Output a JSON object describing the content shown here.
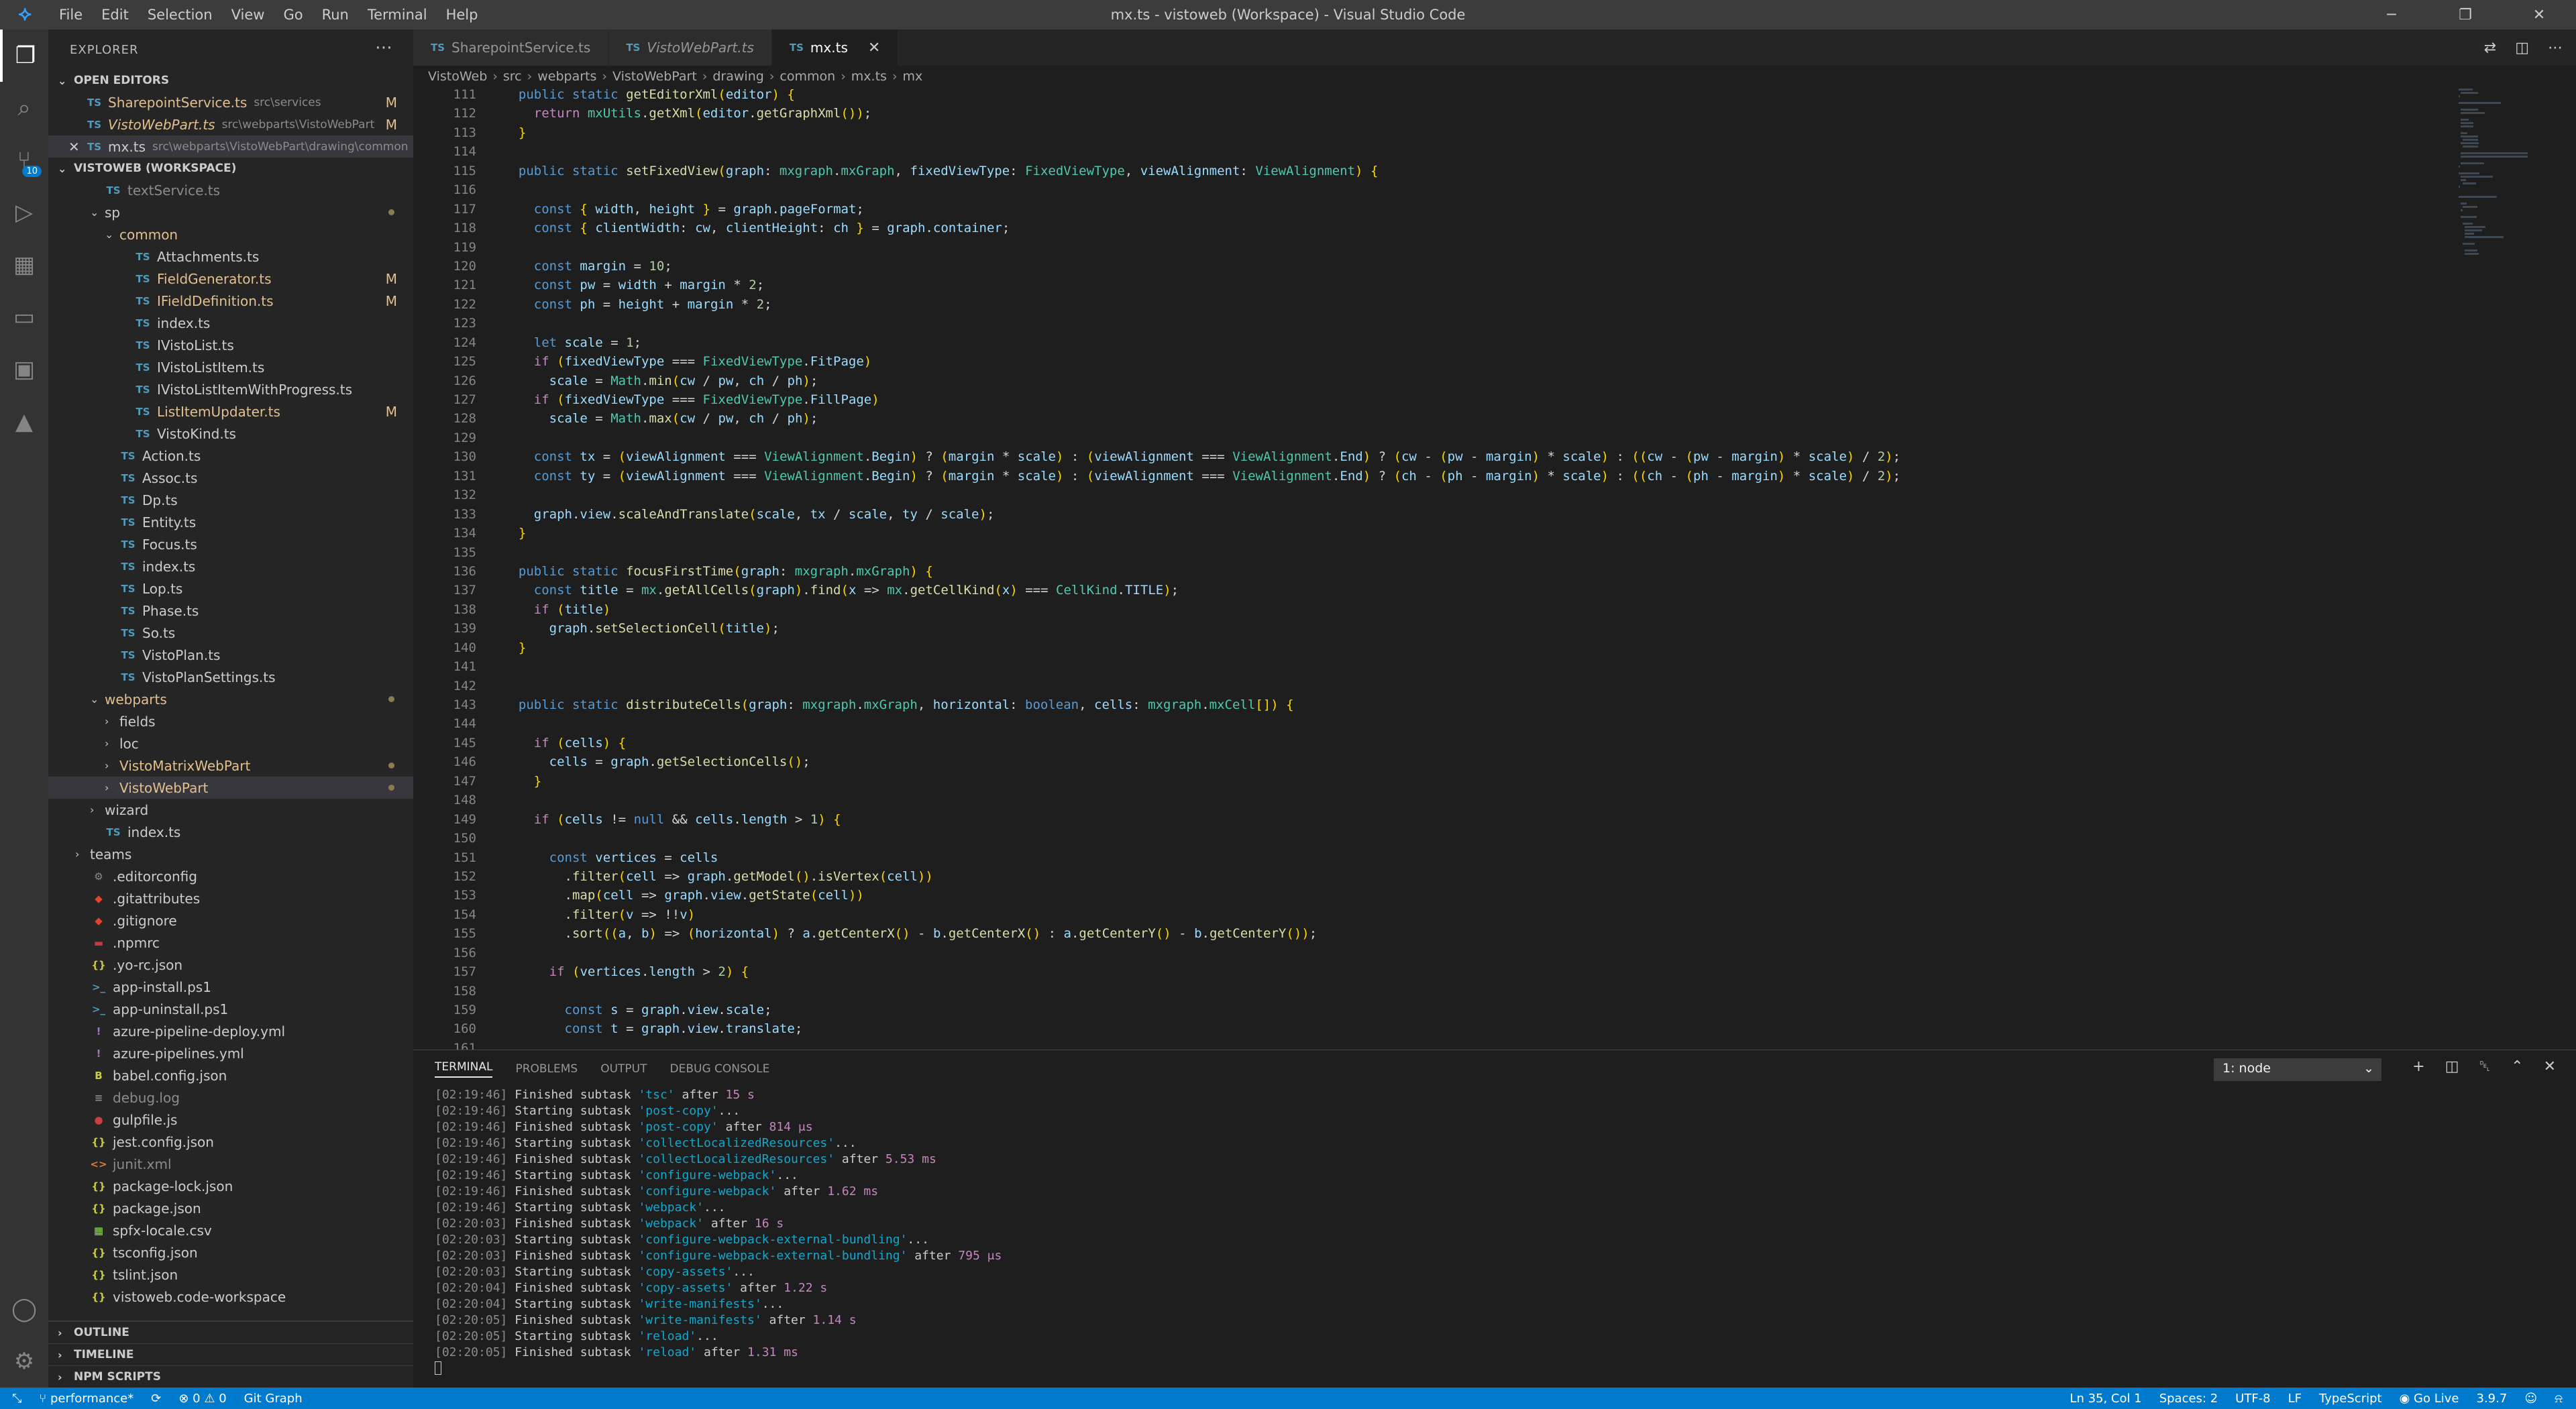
{
  "titlebar": {
    "menu": [
      "File",
      "Edit",
      "Selection",
      "View",
      "Go",
      "Run",
      "Terminal",
      "Help"
    ],
    "title": "mx.ts - vistoweb (Workspace) - Visual Studio Code"
  },
  "activity": {
    "scm_badge": "10"
  },
  "sidebar": {
    "header": "EXPLORER",
    "open_editors_title": "OPEN EDITORS",
    "open_editors": [
      {
        "name": "SharepointService.ts",
        "path": "src\\services",
        "modified": "M",
        "italic": false
      },
      {
        "name": "VistoWebPart.ts",
        "path": "src\\webparts\\VistoWebPart",
        "modified": "M",
        "italic": true
      },
      {
        "name": "mx.ts",
        "path": "src\\webparts\\VistoWebPart\\drawing\\common",
        "modified": "",
        "italic": false
      }
    ],
    "workspace_title": "VISTOWEB (WORKSPACE)",
    "tree": [
      {
        "indent": 1,
        "type": "file",
        "name": "textService.ts",
        "style": "dim"
      },
      {
        "indent": 1,
        "type": "folder",
        "open": true,
        "name": "sp",
        "dot": true
      },
      {
        "indent": 2,
        "type": "folder",
        "open": true,
        "name": "common",
        "color": "mod"
      },
      {
        "indent": 3,
        "type": "ts",
        "name": "Attachments.ts"
      },
      {
        "indent": 3,
        "type": "ts",
        "name": "FieldGenerator.ts",
        "m": "M",
        "color": "mod"
      },
      {
        "indent": 3,
        "type": "ts",
        "name": "IFieldDefinition.ts",
        "m": "M",
        "color": "mod"
      },
      {
        "indent": 3,
        "type": "ts",
        "name": "index.ts"
      },
      {
        "indent": 3,
        "type": "ts",
        "name": "IVistoList.ts"
      },
      {
        "indent": 3,
        "type": "ts",
        "name": "IVistoListItem.ts"
      },
      {
        "indent": 3,
        "type": "ts",
        "name": "IVistoListItemWithProgress.ts"
      },
      {
        "indent": 3,
        "type": "ts",
        "name": "ListItemUpdater.ts",
        "m": "M",
        "color": "mod"
      },
      {
        "indent": 3,
        "type": "ts",
        "name": "VistoKind.ts"
      },
      {
        "indent": 2,
        "type": "ts",
        "name": "Action.ts"
      },
      {
        "indent": 2,
        "type": "ts",
        "name": "Assoc.ts"
      },
      {
        "indent": 2,
        "type": "ts",
        "name": "Dp.ts"
      },
      {
        "indent": 2,
        "type": "ts",
        "name": "Entity.ts"
      },
      {
        "indent": 2,
        "type": "ts",
        "name": "Focus.ts"
      },
      {
        "indent": 2,
        "type": "ts",
        "name": "index.ts"
      },
      {
        "indent": 2,
        "type": "ts",
        "name": "Lop.ts"
      },
      {
        "indent": 2,
        "type": "ts",
        "name": "Phase.ts"
      },
      {
        "indent": 2,
        "type": "ts",
        "name": "So.ts"
      },
      {
        "indent": 2,
        "type": "ts",
        "name": "VistoPlan.ts"
      },
      {
        "indent": 2,
        "type": "ts",
        "name": "VistoPlanSettings.ts"
      },
      {
        "indent": 1,
        "type": "folder",
        "open": true,
        "name": "webparts",
        "dot": true,
        "color": "mod"
      },
      {
        "indent": 2,
        "type": "folder",
        "open": false,
        "name": "fields"
      },
      {
        "indent": 2,
        "type": "folder",
        "open": false,
        "name": "loc"
      },
      {
        "indent": 2,
        "type": "folder",
        "open": false,
        "name": "VistoMatrixWebPart",
        "dot": true,
        "color": "mod"
      },
      {
        "indent": 2,
        "type": "folder",
        "open": false,
        "name": "VistoWebPart",
        "dot": true,
        "color": "mod",
        "selected": true
      },
      {
        "indent": 1,
        "type": "folder",
        "open": false,
        "name": "wizard"
      },
      {
        "indent": 1,
        "type": "ts",
        "name": "index.ts"
      },
      {
        "indent": 0,
        "type": "folder",
        "open": false,
        "name": "teams"
      },
      {
        "indent": 0,
        "type": "gear",
        "name": ".editorconfig"
      },
      {
        "indent": 0,
        "type": "git",
        "name": ".gitattributes"
      },
      {
        "indent": 0,
        "type": "git",
        "name": ".gitignore"
      },
      {
        "indent": 0,
        "type": "npm",
        "name": ".npmrc"
      },
      {
        "indent": 0,
        "type": "json",
        "name": ".yo-rc.json"
      },
      {
        "indent": 0,
        "type": "ps",
        "name": "app-install.ps1"
      },
      {
        "indent": 0,
        "type": "ps",
        "name": "app-uninstall.ps1"
      },
      {
        "indent": 0,
        "type": "yml",
        "name": "azure-pipeline-deploy.yml"
      },
      {
        "indent": 0,
        "type": "yml",
        "name": "azure-pipelines.yml"
      },
      {
        "indent": 0,
        "type": "babel",
        "name": "babel.config.json"
      },
      {
        "indent": 0,
        "type": "log",
        "name": "debug.log",
        "style": "dim"
      },
      {
        "indent": 0,
        "type": "gulp",
        "name": "gulpfile.js"
      },
      {
        "indent": 0,
        "type": "json",
        "name": "jest.config.json"
      },
      {
        "indent": 0,
        "type": "xml",
        "name": "junit.xml",
        "style": "dim"
      },
      {
        "indent": 0,
        "type": "json",
        "name": "package-lock.json"
      },
      {
        "indent": 0,
        "type": "json",
        "name": "package.json"
      },
      {
        "indent": 0,
        "type": "csv",
        "name": "spfx-locale.csv"
      },
      {
        "indent": 0,
        "type": "json",
        "name": "tsconfig.json"
      },
      {
        "indent": 0,
        "type": "json",
        "name": "tslint.json"
      },
      {
        "indent": 0,
        "type": "json",
        "name": "vistoweb.code-workspace"
      }
    ],
    "bottom_sections": [
      "OUTLINE",
      "TIMELINE",
      "NPM SCRIPTS"
    ]
  },
  "editor": {
    "tabs": [
      {
        "label": "SharepointService.ts",
        "italic": false,
        "active": false
      },
      {
        "label": "VistoWebPart.ts",
        "italic": true,
        "active": false
      },
      {
        "label": "mx.ts",
        "italic": false,
        "active": true
      }
    ],
    "breadcrumb": [
      "VistoWeb",
      "src",
      "webparts",
      "VistoWebPart",
      "drawing",
      "common",
      "mx.ts",
      "mx"
    ],
    "first_line": 111,
    "lines": [
      "  public static getEditorXml(editor) {",
      "    return mxUtils.getXml(editor.getGraphXml());",
      "  }",
      "",
      "  public static setFixedView(graph: mxgraph.mxGraph, fixedViewType: FixedViewType, viewAlignment: ViewAlignment) {",
      "",
      "    const { width, height } = graph.pageFormat;",
      "    const { clientWidth: cw, clientHeight: ch } = graph.container;",
      "",
      "    const margin = 10;",
      "    const pw = width + margin * 2;",
      "    const ph = height + margin * 2;",
      "",
      "    let scale = 1;",
      "    if (fixedViewType === FixedViewType.FitPage)",
      "      scale = Math.min(cw / pw, ch / ph);",
      "    if (fixedViewType === FixedViewType.FillPage)",
      "      scale = Math.max(cw / pw, ch / ph);",
      "",
      "    const tx = (viewAlignment === ViewAlignment.Begin) ? (margin * scale) : (viewAlignment === ViewAlignment.End) ? (cw - (pw - margin) * scale) : ((cw - (pw - margin) * scale) / 2);",
      "    const ty = (viewAlignment === ViewAlignment.Begin) ? (margin * scale) : (viewAlignment === ViewAlignment.End) ? (ch - (ph - margin) * scale) : ((ch - (ph - margin) * scale) / 2);",
      "",
      "    graph.view.scaleAndTranslate(scale, tx / scale, ty / scale);",
      "  }",
      "",
      "  public static focusFirstTime(graph: mxgraph.mxGraph) {",
      "    const title = mx.getAllCells(graph).find(x => mx.getCellKind(x) === CellKind.TITLE);",
      "    if (title)",
      "      graph.setSelectionCell(title);",
      "  }",
      "",
      "",
      "  public static distributeCells(graph: mxgraph.mxGraph, horizontal: boolean, cells: mxgraph.mxCell[]) {",
      "",
      "    if (cells) {",
      "      cells = graph.getSelectionCells();",
      "    }",
      "",
      "    if (cells != null && cells.length > 1) {",
      "",
      "      const vertices = cells",
      "        .filter(cell => graph.getModel().isVertex(cell))",
      "        .map(cell => graph.view.getState(cell))",
      "        .filter(v => !!v)",
      "        .sort((a, b) => (horizontal) ? a.getCenterX() - b.getCenterX() : a.getCenterY() - b.getCenterY());",
      "",
      "      if (vertices.length > 2) {",
      "",
      "        const s = graph.view.scale;",
      "        const t = graph.view.translate;",
      ""
    ]
  },
  "panel": {
    "tabs": [
      "TERMINAL",
      "PROBLEMS",
      "OUTPUT",
      "DEBUG CONSOLE"
    ],
    "terminal_select": "1: node",
    "lines": [
      {
        "time": "[02:19:46]",
        "verb": "Finished subtask",
        "task": "'tsc'",
        "after": " after ",
        "dur": "15 s"
      },
      {
        "time": "[02:19:46]",
        "verb": "Starting subtask",
        "task": "'post-copy'",
        "after": "...",
        "dur": ""
      },
      {
        "time": "[02:19:46]",
        "verb": "Finished subtask",
        "task": "'post-copy'",
        "after": " after ",
        "dur": "814 μs"
      },
      {
        "time": "[02:19:46]",
        "verb": "Starting subtask",
        "task": "'collectLocalizedResources'",
        "after": "...",
        "dur": ""
      },
      {
        "time": "[02:19:46]",
        "verb": "Finished subtask",
        "task": "'collectLocalizedResources'",
        "after": " after ",
        "dur": "5.53 ms"
      },
      {
        "time": "[02:19:46]",
        "verb": "Starting subtask",
        "task": "'configure-webpack'",
        "after": "...",
        "dur": ""
      },
      {
        "time": "[02:19:46]",
        "verb": "Finished subtask",
        "task": "'configure-webpack'",
        "after": " after ",
        "dur": "1.62 ms"
      },
      {
        "time": "[02:19:46]",
        "verb": "Starting subtask",
        "task": "'webpack'",
        "after": "...",
        "dur": ""
      },
      {
        "time": "[02:20:03]",
        "verb": "Finished subtask",
        "task": "'webpack'",
        "after": " after ",
        "dur": "16 s"
      },
      {
        "time": "[02:20:03]",
        "verb": "Starting subtask",
        "task": "'configure-webpack-external-bundling'",
        "after": "...",
        "dur": ""
      },
      {
        "time": "[02:20:03]",
        "verb": "Finished subtask",
        "task": "'configure-webpack-external-bundling'",
        "after": " after ",
        "dur": "795 μs"
      },
      {
        "time": "[02:20:03]",
        "verb": "Starting subtask",
        "task": "'copy-assets'",
        "after": "...",
        "dur": ""
      },
      {
        "time": "[02:20:04]",
        "verb": "Finished subtask",
        "task": "'copy-assets'",
        "after": " after ",
        "dur": "1.22 s"
      },
      {
        "time": "[02:20:04]",
        "verb": "Starting subtask",
        "task": "'write-manifests'",
        "after": "...",
        "dur": ""
      },
      {
        "time": "[02:20:05]",
        "verb": "Finished subtask",
        "task": "'write-manifests'",
        "after": " after ",
        "dur": "1.14 s"
      },
      {
        "time": "[02:20:05]",
        "verb": "Starting subtask",
        "task": "'reload'",
        "after": "...",
        "dur": ""
      },
      {
        "time": "[02:20:05]",
        "verb": "Finished subtask",
        "task": "'reload'",
        "after": " after ",
        "dur": "1.31 ms"
      }
    ]
  },
  "statusbar": {
    "branch": "performance*",
    "errors": "0",
    "warnings": "0",
    "git_graph": "Git Graph",
    "position": "Ln 35, Col 1",
    "spaces": "Spaces: 2",
    "encoding": "UTF-8",
    "eol": "LF",
    "language": "TypeScript",
    "golive": "Go Live",
    "version": "3.9.7"
  },
  "colors": {
    "accent": "#007acc",
    "modified": "#e2c08d"
  }
}
